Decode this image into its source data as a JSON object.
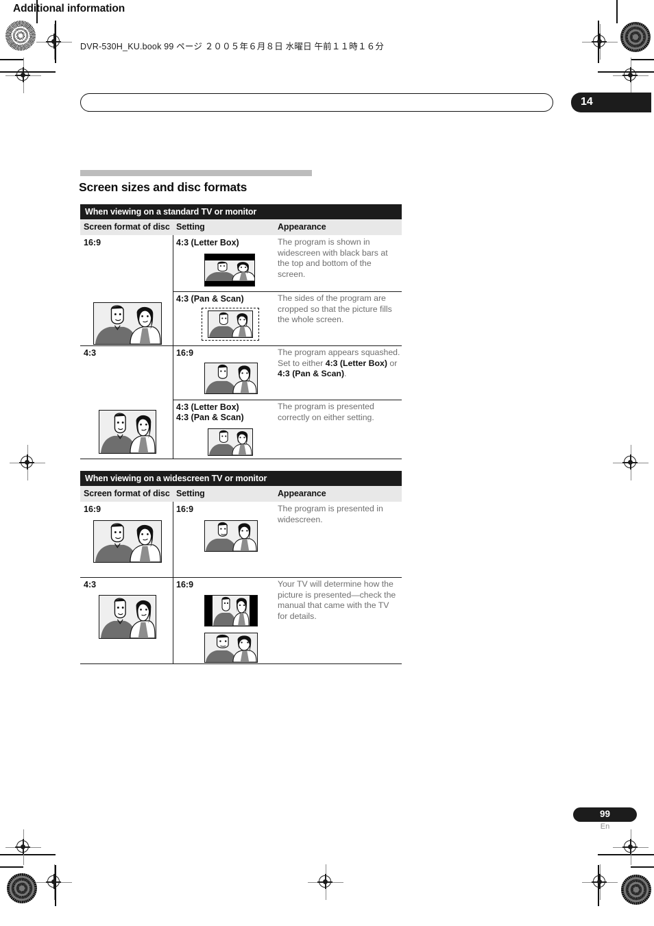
{
  "print_info": {
    "file_line": "DVR-530H_KU.book  99 ページ  ２００５年６月８日   水曜日   午前１１時１６分"
  },
  "running_head": {
    "title": "Additional information",
    "chapter_number": "14"
  },
  "section": {
    "heading": "Screen sizes and disc formats"
  },
  "colors": {
    "banner_bg": "#1c1c1c",
    "colhead_bg": "#e8e8e8",
    "rule_bar": "#bcbcbc",
    "body_text": "#6e6e6e",
    "emphasis_text": "#111111"
  },
  "tables": [
    {
      "banner": "When viewing on a standard TV or monitor",
      "columns": [
        "Screen format of disc",
        "Setting",
        "Appearance"
      ],
      "groups": [
        {
          "format": "16:9",
          "format_picture": "widescreen-people-illustration",
          "rows": [
            {
              "setting": "4:3 (Letter Box)",
              "appearance": "The program is shown in widescreen with black bars at the top and bottom of the screen.",
              "picture": "letterbox-people-illustration"
            },
            {
              "setting": "4:3 (Pan & Scan)",
              "appearance": "The sides of the program are cropped so that the picture fills the whole screen.",
              "picture": "panscan-cropped-people-illustration"
            }
          ]
        },
        {
          "format": "4:3",
          "format_picture": "standard-people-illustration",
          "rows": [
            {
              "setting": "16:9",
              "appearance_parts": [
                {
                  "text": "The program appears squashed. Set to either ",
                  "bold": false
                },
                {
                  "text": "4:3 (Letter Box)",
                  "bold": true
                },
                {
                  "text": " or ",
                  "bold": false
                },
                {
                  "text": "4:3 (Pan & Scan)",
                  "bold": true
                },
                {
                  "text": ".",
                  "bold": false
                }
              ],
              "picture": "squashed-people-illustration"
            },
            {
              "setting": "4:3 (Letter Box)\n4:3 (Pan & Scan)",
              "setting_line1": "4:3 (Letter Box)",
              "setting_line2": "4:3 (Pan & Scan)",
              "appearance": "The program is presented correctly on either setting.",
              "picture": "correct-people-illustration"
            }
          ]
        }
      ]
    },
    {
      "banner": "When viewing on a widescreen TV or monitor",
      "columns": [
        "Screen format of disc",
        "Setting",
        "Appearance"
      ],
      "groups": [
        {
          "format": "16:9",
          "format_picture": "widescreen-people-illustration",
          "rows": [
            {
              "setting": "16:9",
              "appearance": "The program is presented in widescreen.",
              "picture": "widescreen-people-illustration"
            }
          ]
        },
        {
          "format": "4:3",
          "format_picture": "standard-people-illustration",
          "rows": [
            {
              "setting": "16:9",
              "appearance": "Your TV will determine how the picture is presented—check the manual that came with the TV for details.",
              "picture": "pillarbox-people-illustration",
              "picture2": "stretched-people-illustration"
            }
          ]
        }
      ]
    }
  ],
  "footer": {
    "page_number": "99",
    "language": "En"
  }
}
